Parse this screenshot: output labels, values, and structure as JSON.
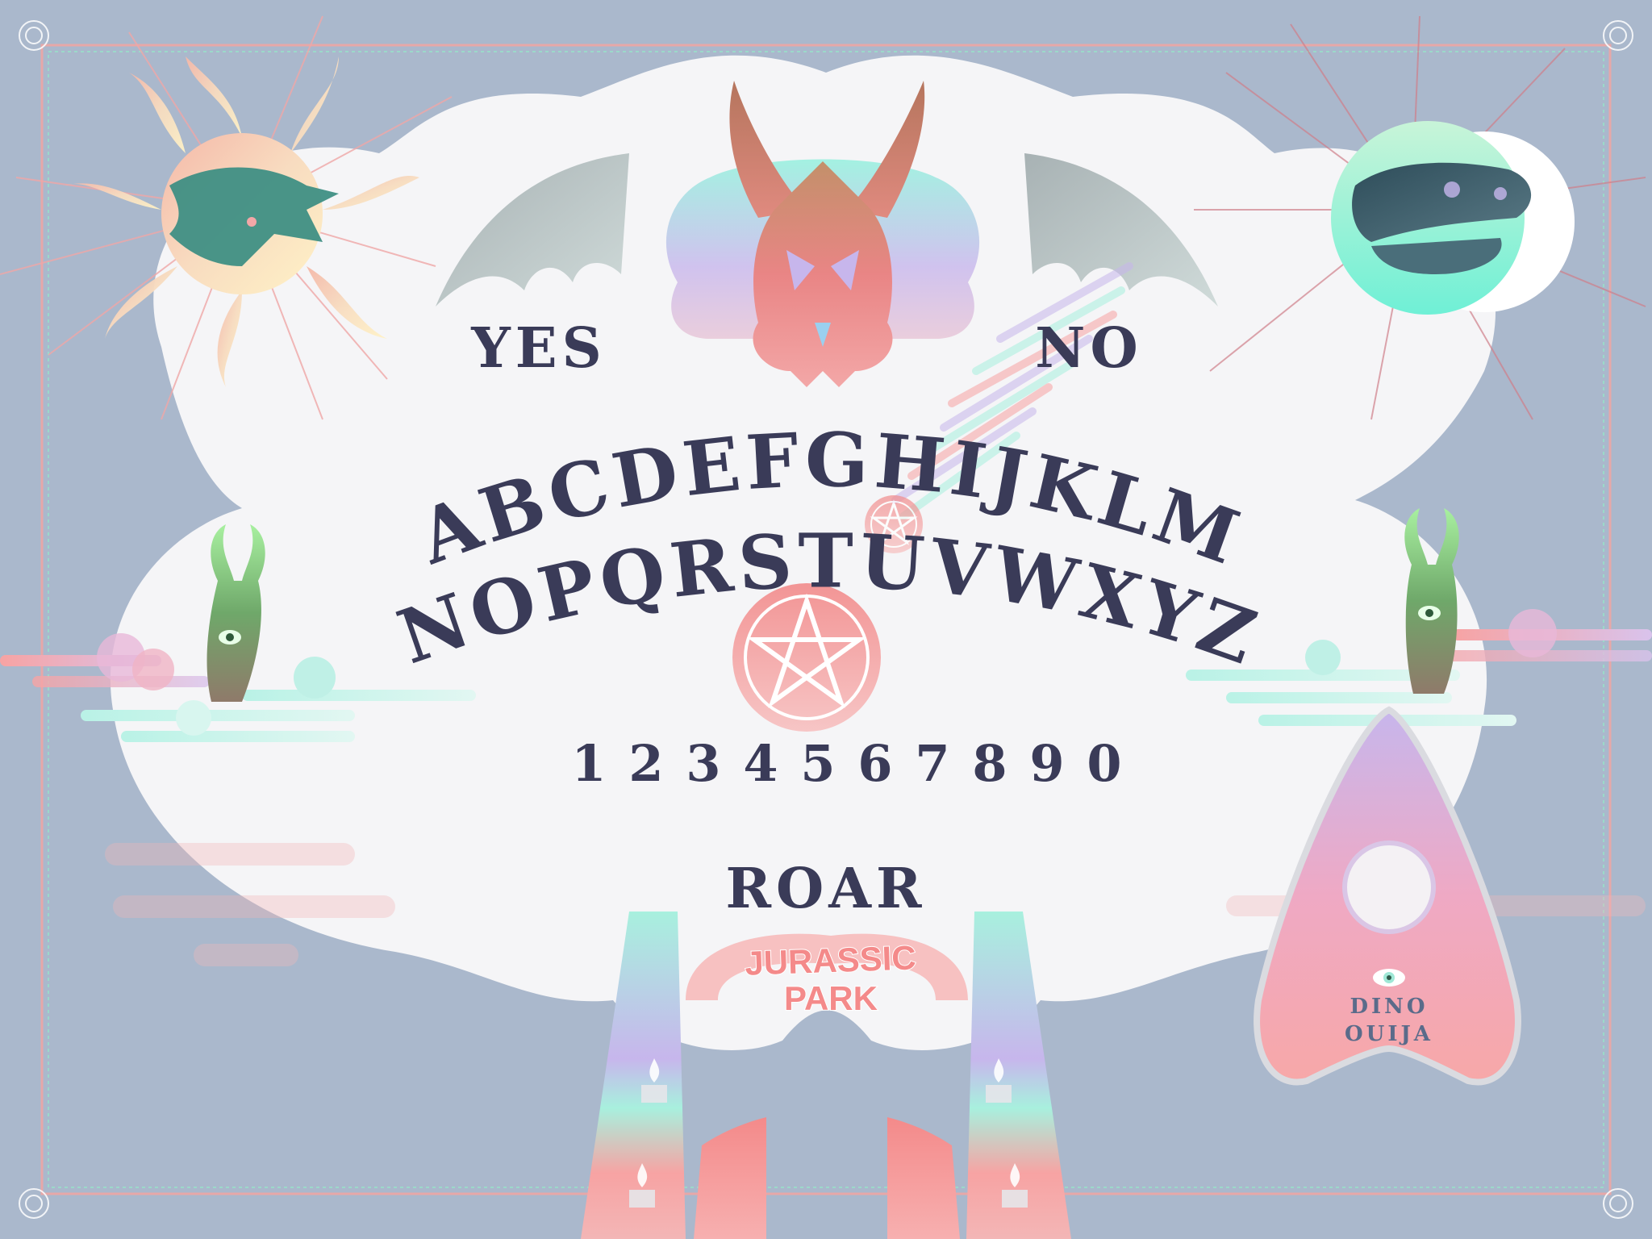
{
  "board": {
    "yes_label": "YES",
    "no_label": "NO",
    "goodbye_label": "ROAR",
    "alphabet_row1": [
      "A",
      "B",
      "C",
      "D",
      "E",
      "F",
      "G",
      "H",
      "I",
      "J",
      "K",
      "L",
      "M"
    ],
    "alphabet_row2": [
      "N",
      "O",
      "P",
      "Q",
      "R",
      "S",
      "T",
      "U",
      "V",
      "W",
      "X",
      "Y",
      "Z"
    ],
    "numbers": [
      "1",
      "2",
      "3",
      "4",
      "5",
      "6",
      "7",
      "8",
      "9",
      "0"
    ]
  },
  "gate": {
    "sign_line1": "JURASSIC",
    "sign_line2": "PARK"
  },
  "planchette": {
    "line1": "DINO",
    "line2": "OUIJA"
  },
  "colors": {
    "background": "#aab8cc",
    "board": "#f5f5f7",
    "ink": "#3a3b58",
    "accent_pink": "#f48a8a",
    "accent_mint": "#8ff0dc",
    "accent_lavender": "#c7b6ec"
  },
  "icons": [
    "sun-dragon-icon",
    "demon-skull-icon",
    "moon-trex-icon",
    "pentagram-icon",
    "horned-creature-icon",
    "torch-flame-icon",
    "eye-icon"
  ]
}
